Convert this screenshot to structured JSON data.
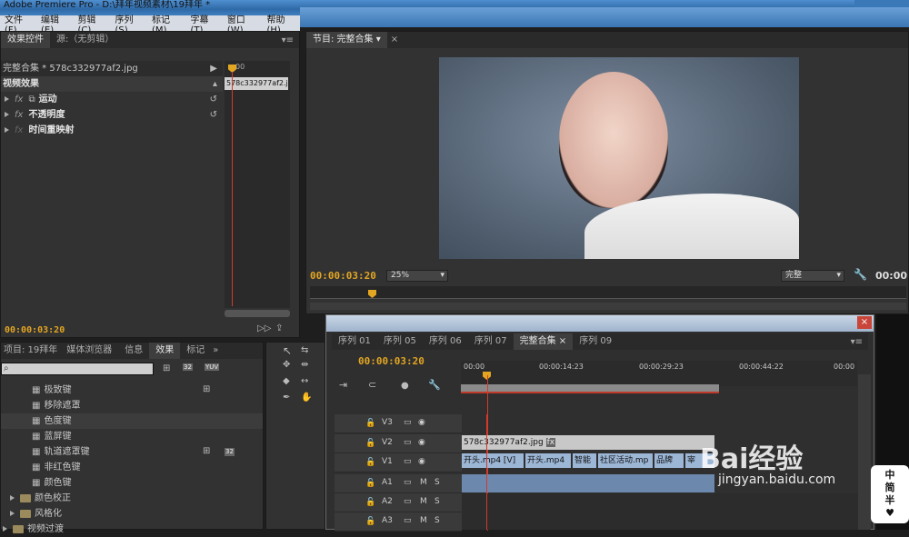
{
  "app": {
    "title": "Adobe Premiere Pro - D:\\拜年视频素材\\19拜年 *"
  },
  "menu": [
    "文件(F)",
    "编辑(E)",
    "剪辑(C)",
    "序列(S)",
    "标记(M)",
    "字幕(T)",
    "窗口(W)",
    "帮助(H)"
  ],
  "effect_controls": {
    "tabs": [
      "效果控件",
      "源:（无剪辑）"
    ],
    "clip_path": "完整合集 * 578c332977af2.jpg",
    "ruler_time": "00",
    "clip_chip": "578c332977af2.j",
    "section": "视频效果",
    "effects": [
      "运动",
      "不透明度",
      "时间重映射"
    ],
    "fx_glyph": "fx",
    "timecode": "00:00:03:20"
  },
  "program": {
    "tab": "节目: 完整合集",
    "timecode": "00:00:03:20",
    "zoom": "25%",
    "quality": "完整",
    "duration": "00:00"
  },
  "project": {
    "tabs": [
      "项目: 19拜年",
      "媒体浏览器",
      "信息",
      "效果",
      "标记"
    ],
    "search_placeholder": "",
    "badges": [
      "32",
      "YUV"
    ],
    "items": [
      {
        "label": "极致键",
        "kind": "effect"
      },
      {
        "label": "移除遮罩",
        "kind": "effect"
      },
      {
        "label": "色度键",
        "kind": "effect"
      },
      {
        "label": "蓝屏键",
        "kind": "effect"
      },
      {
        "label": "轨道遮罩键",
        "kind": "effect"
      },
      {
        "label": "非红色键",
        "kind": "effect"
      },
      {
        "label": "颜色键",
        "kind": "effect"
      },
      {
        "label": "颜色校正",
        "kind": "folder"
      },
      {
        "label": "风格化",
        "kind": "folder"
      },
      {
        "label": "视频过渡",
        "kind": "folder"
      }
    ],
    "row_badge": "32"
  },
  "timeline": {
    "tabs": [
      "序列 01",
      "序列 05",
      "序列 06",
      "序列 07",
      "完整合集",
      "序列 09"
    ],
    "timecode": "00:00:03:20",
    "ruler": [
      "00:00",
      "00:00:14:23",
      "00:00:29:23",
      "00:00:44:22",
      "00:00"
    ],
    "tracks": [
      "V3",
      "V2",
      "V1",
      "A1",
      "A2",
      "A3"
    ],
    "track_m": "M",
    "track_s": "S",
    "v2_clip": "578c332977af2.jpg",
    "v1_clips": [
      "开头.mp4 [V]",
      "开头.mp4",
      "智能",
      "社区活动.mp",
      "品牌",
      "宰"
    ],
    "fx_badge": "fx"
  },
  "watermark": {
    "brand": "Bai经验",
    "url": "jingyan.baidu.com",
    "badge": [
      "中",
      "简",
      "半"
    ]
  }
}
